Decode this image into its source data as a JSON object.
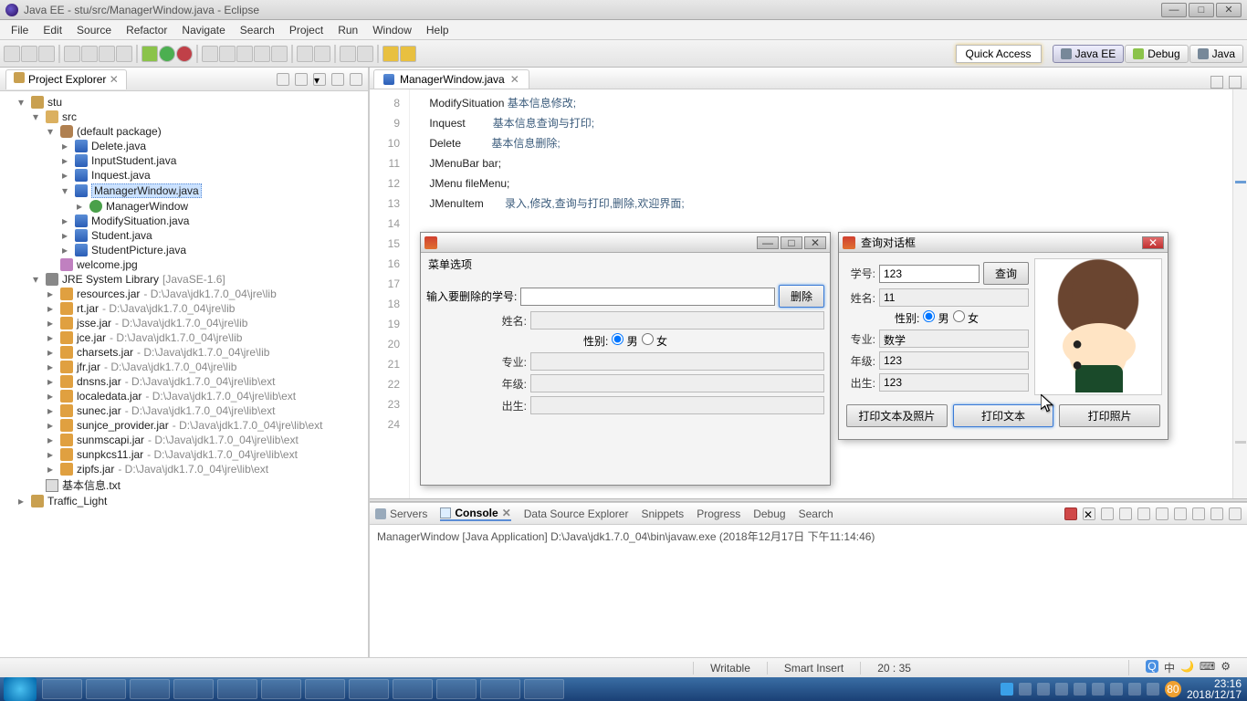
{
  "window": {
    "title": "Java EE - stu/src/ManagerWindow.java - Eclipse"
  },
  "menu": [
    "File",
    "Edit",
    "Source",
    "Refactor",
    "Navigate",
    "Search",
    "Project",
    "Run",
    "Window",
    "Help"
  ],
  "quick_access": "Quick Access",
  "perspectives": {
    "javaee": "Java EE",
    "debug": "Debug",
    "java": "Java"
  },
  "explorer": {
    "title": "Project Explorer",
    "nodes": {
      "proj": "stu",
      "src": "src",
      "pkg": "(default package)",
      "files": [
        "Delete.java",
        "InputStudent.java",
        "Inquest.java",
        "ManagerWindow.java",
        "ManagerWindow",
        "ModifySituation.java",
        "Student.java",
        "StudentPicture.java"
      ],
      "welcome": "welcome.jpg",
      "jre": "JRE System Library",
      "jre_ver": "[JavaSE-1.6]",
      "jars": [
        {
          "n": "resources.jar",
          "p": "D:\\Java\\jdk1.7.0_04\\jre\\lib"
        },
        {
          "n": "rt.jar",
          "p": "D:\\Java\\jdk1.7.0_04\\jre\\lib"
        },
        {
          "n": "jsse.jar",
          "p": "D:\\Java\\jdk1.7.0_04\\jre\\lib"
        },
        {
          "n": "jce.jar",
          "p": "D:\\Java\\jdk1.7.0_04\\jre\\lib"
        },
        {
          "n": "charsets.jar",
          "p": "D:\\Java\\jdk1.7.0_04\\jre\\lib"
        },
        {
          "n": "jfr.jar",
          "p": "D:\\Java\\jdk1.7.0_04\\jre\\lib"
        },
        {
          "n": "dnsns.jar",
          "p": "D:\\Java\\jdk1.7.0_04\\jre\\lib\\ext"
        },
        {
          "n": "localedata.jar",
          "p": "D:\\Java\\jdk1.7.0_04\\jre\\lib\\ext"
        },
        {
          "n": "sunec.jar",
          "p": "D:\\Java\\jdk1.7.0_04\\jre\\lib\\ext"
        },
        {
          "n": "sunjce_provider.jar",
          "p": "D:\\Java\\jdk1.7.0_04\\jre\\lib\\ext"
        },
        {
          "n": "sunmscapi.jar",
          "p": "D:\\Java\\jdk1.7.0_04\\jre\\lib\\ext"
        },
        {
          "n": "sunpkcs11.jar",
          "p": "D:\\Java\\jdk1.7.0_04\\jre\\lib\\ext"
        },
        {
          "n": "zipfs.jar",
          "p": "D:\\Java\\jdk1.7.0_04\\jre\\lib\\ext"
        }
      ],
      "txt": "基本信息.txt",
      "traffic": "Traffic_Light"
    }
  },
  "editor": {
    "tab": "ManagerWindow.java",
    "lines": [
      {
        "n": 8,
        "t": "ModifySituation",
        "c": "基本信息修改;"
      },
      {
        "n": 9,
        "t": "Inquest",
        "c": "基本信息查询与打印;"
      },
      {
        "n": 10,
        "t": "Delete",
        "c": "基本信息删除;"
      },
      {
        "n": 11,
        "t": "JMenuBar bar;",
        "c": ""
      },
      {
        "n": 12,
        "t": "JMenu fileMenu;",
        "c": ""
      },
      {
        "n": 13,
        "t": "JMenuItem ",
        "c": "录入,修改,查询与打印,删除,欢迎界面;"
      },
      {
        "n": 14,
        "t": "",
        "c": ""
      },
      {
        "n": 15,
        "t": "",
        "c": ""
      },
      {
        "n": 16,
        "t": "",
        "c": ""
      },
      {
        "n": 17,
        "t": "",
        "c": ""
      },
      {
        "n": 18,
        "t": "",
        "c": ""
      },
      {
        "n": 19,
        "t": "",
        "c": ""
      },
      {
        "n": 20,
        "t": "",
        "c": ""
      },
      {
        "n": 21,
        "t": "",
        "c": ""
      },
      {
        "n": 22,
        "t": "",
        "c": ""
      },
      {
        "n": 23,
        "t": "",
        "c": ""
      },
      {
        "n": 24,
        "t": "",
        "c": ""
      }
    ]
  },
  "console_tabs": {
    "servers": "Servers",
    "console": "Console",
    "dse": "Data Source Explorer",
    "snippets": "Snippets",
    "progress": "Progress",
    "debug": "Debug",
    "search": "Search"
  },
  "console_line": "ManagerWindow [Java Application] D:\\Java\\jdk1.7.0_04\\bin\\javaw.exe (2018年12月17日 下午11:14:46)",
  "status": {
    "writable": "Writable",
    "insert": "Smart Insert",
    "pos": "20 : 35"
  },
  "delete_dialog": {
    "menu": "菜单选项",
    "lbl_input": "输入要删除的学号:",
    "btn_delete": "删除",
    "lbl_name": "姓名:",
    "lbl_sex": "性别:",
    "opt_m": "男",
    "opt_f": "女",
    "lbl_major": "专业:",
    "lbl_grade": "年级:",
    "lbl_birth": "出生:"
  },
  "query_dialog": {
    "title": "查询对话框",
    "lbl_id": "学号:",
    "val_id": "123",
    "btn_query": "查询",
    "lbl_name": "姓名:",
    "val_name": "11",
    "lbl_sex": "性别:",
    "opt_m": "男",
    "opt_f": "女",
    "lbl_major": "专业:",
    "val_major": "数学",
    "lbl_grade": "年级:",
    "val_grade": "123",
    "lbl_birth": "出生:",
    "val_birth": "123",
    "btn1": "打印文本及照片",
    "btn2": "打印文本",
    "btn3": "打印照片"
  },
  "tray": {
    "time": "23:16",
    "date": "2018/12/17",
    "badge": "80"
  }
}
